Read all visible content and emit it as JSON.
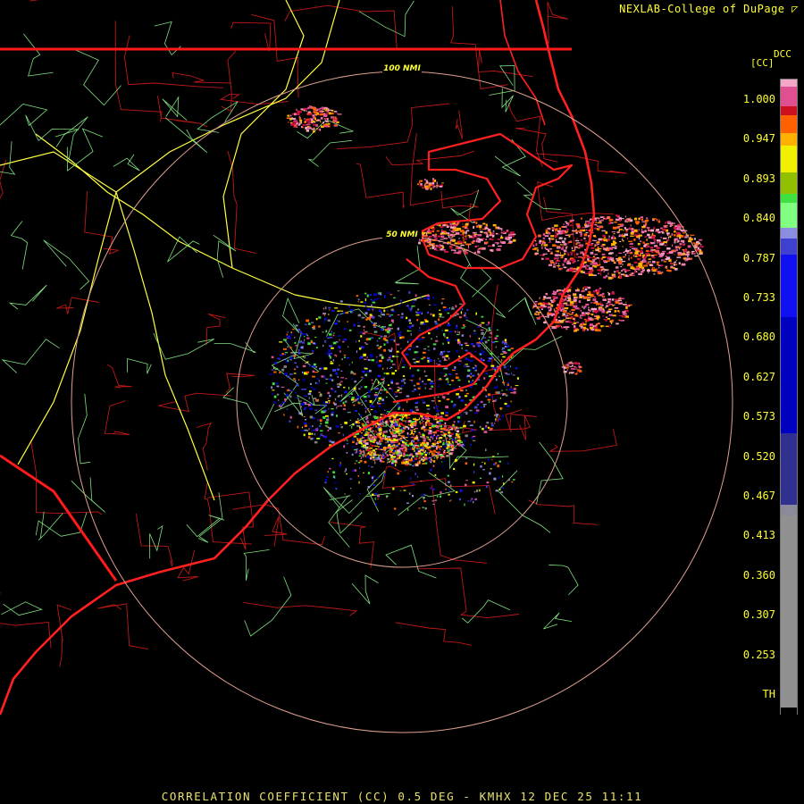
{
  "credit": "NEXLAB-College of DuPage",
  "product_code": "DCC",
  "unit_label": "[CC]",
  "footer_text": "CORRELATION COEFFICIENT (CC) 0.5 DEG - KMHX 12 DEC 25 11:11",
  "rings": [
    {
      "label": "100 NMI"
    },
    {
      "label": "50 NMI"
    }
  ],
  "legend": {
    "labels": [
      "1.000",
      "0.947",
      "0.893",
      "0.840",
      "0.787",
      "0.733",
      "0.680",
      "0.627",
      "0.573",
      "0.520",
      "0.467",
      "0.413",
      "0.360",
      "0.307",
      "0.253",
      "TH"
    ],
    "bands": [
      {
        "color": "#f4a8c8",
        "from": 1.0
      },
      {
        "color": "#e05090",
        "from": 0.98
      },
      {
        "color": "#cc1020",
        "from": 0.96
      },
      {
        "color": "#ff6000",
        "from": 0.945
      },
      {
        "color": "#ffb000",
        "from": 0.92
      },
      {
        "color": "#f0f000",
        "from": 0.895
      },
      {
        "color": "#90c000",
        "from": 0.86
      },
      {
        "color": "#40e040",
        "from": 0.8
      },
      {
        "color": "#80ff80",
        "from": 0.78
      },
      {
        "color": "#8c8ce0",
        "from": 0.76
      },
      {
        "color": "#4040d0",
        "from": 0.74
      },
      {
        "color": "#1010f0",
        "from": 0.72
      },
      {
        "color": "#0000c0",
        "from": 0.56
      },
      {
        "color": "#303090",
        "from": 0.44
      },
      {
        "color": "#8a8a9a",
        "from": 0.42
      },
      {
        "color": "#909090",
        "from": 0.4
      },
      {
        "color": "#000000",
        "from": 0.22
      }
    ]
  },
  "colors": {
    "state_border": "#ff1a1a",
    "county_border": "#c01818",
    "highway": "#ffff40",
    "road": "#80e080",
    "coast": "#ff2020",
    "range_ring": "#e0a090",
    "label": "#ffff33"
  }
}
